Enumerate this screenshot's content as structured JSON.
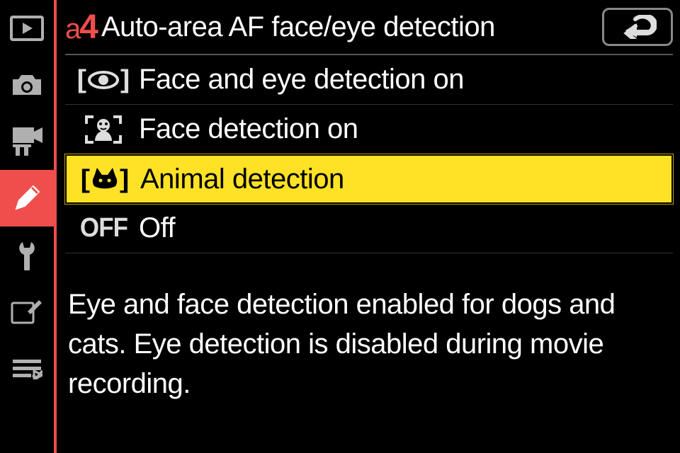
{
  "sidebar": {
    "items": [
      {
        "name": "playback"
      },
      {
        "name": "photo-shooting"
      },
      {
        "name": "movie-shooting"
      },
      {
        "name": "custom-settings",
        "active": true
      },
      {
        "name": "setup"
      },
      {
        "name": "retouch"
      },
      {
        "name": "my-menu"
      }
    ]
  },
  "header": {
    "code_letter": "a",
    "code_number": "4",
    "title": "Auto-area AF face/eye detection"
  },
  "options": [
    {
      "id": "face-eye-on",
      "label": "Face and eye detection on",
      "icon": "eye-bracket",
      "selected": false
    },
    {
      "id": "face-on",
      "label": "Face detection on",
      "icon": "face-bracket",
      "selected": false
    },
    {
      "id": "animal",
      "label": "Animal detection",
      "icon": "animal-bracket",
      "selected": true
    },
    {
      "id": "off",
      "label": "Off",
      "icon": "off-text",
      "off_text": "OFF",
      "selected": false
    }
  ],
  "description": "Eye and face detection enabled for dogs and cats. Eye detection is disabled during movie recording."
}
